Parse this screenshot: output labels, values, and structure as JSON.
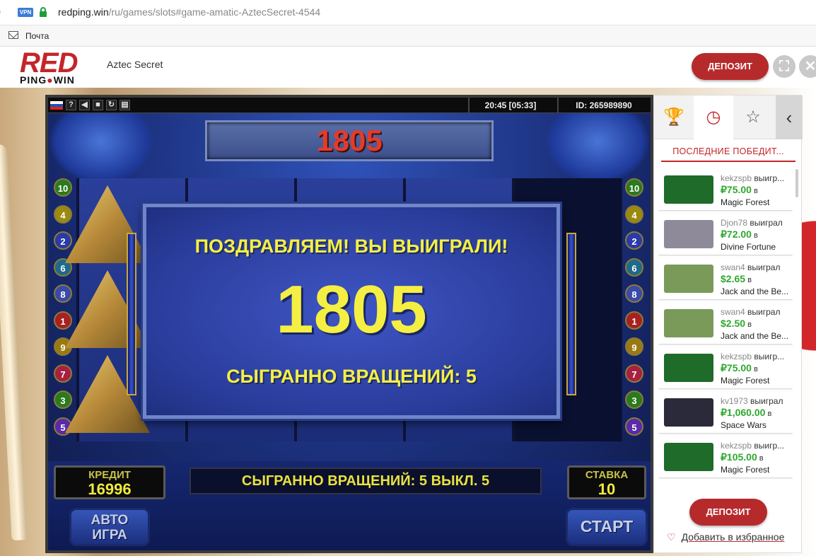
{
  "browser": {
    "vpn_badge": "VPN",
    "url_host": "redping.win",
    "url_path": "/ru/games/slots#game-amatic-AztecSecret-4544",
    "bookmark": "Почта"
  },
  "header": {
    "logo_top": "RED",
    "logo_bottom_left": "PING",
    "logo_bottom_right": "WIN",
    "game_title": "Aztec Secret",
    "deposit_label": "ДЕПОЗИТ",
    "fullscreen_icon": "expand-icon",
    "close_icon": "close-icon"
  },
  "game": {
    "toolbar": {
      "help": "?",
      "clock": "20:45 [05:33]",
      "id": "ID: 265989890"
    },
    "win_top": "1805",
    "line_numbers_left": [
      "10",
      "4",
      "2",
      "6",
      "8",
      "1",
      "9",
      "7",
      "3",
      "5"
    ],
    "line_numbers_right": [
      "10",
      "4",
      "2",
      "6",
      "8",
      "1",
      "9",
      "7",
      "3",
      "5"
    ],
    "dialog": {
      "headline": "ПОЗДРАВЛЯЕМ! ВЫ ВЫИГРАЛИ!",
      "amount": "1805",
      "spins": "СЫГРАННО ВРАЩЕНИЙ: 5"
    },
    "credit_label": "КРЕДИТ",
    "credit_value": "16996",
    "message": "СЫГРАННО ВРАЩЕНИЙ: 5 ВЫКЛ. 5",
    "bet_label": "СТАВКА",
    "bet_value": "10",
    "auto_line1": "АВТО",
    "auto_line2": "ИГРА",
    "start_label": "СТАРТ"
  },
  "sidebar": {
    "tabs": [
      "trophy-icon",
      "clock-icon",
      "star-icon",
      "chevron-left-icon"
    ],
    "heading": "ПОСЛЕДНИЕ ПОБЕДИТ...",
    "winners": [
      {
        "user": "kekzspb",
        "verb": " выигр...",
        "amount": "₽75.00",
        "in": " в",
        "game": "Magic Forest",
        "thumb": "#1f6b2a"
      },
      {
        "user": "Djon78",
        "verb": " выиграл",
        "amount": "₽72.00",
        "in": " в",
        "game": "Divine Fortune",
        "thumb": "#8f8a9a"
      },
      {
        "user": "swan4",
        "verb": " выиграл",
        "amount": "$2.65",
        "in": " в",
        "game": "Jack and the Be...",
        "thumb": "#7a9a5a"
      },
      {
        "user": "swan4",
        "verb": " выиграл",
        "amount": "$2.50",
        "in": " в",
        "game": "Jack and the Be...",
        "thumb": "#7a9a5a"
      },
      {
        "user": "kekzspb",
        "verb": " выигр...",
        "amount": "₽75.00",
        "in": " в",
        "game": "Magic Forest",
        "thumb": "#1f6b2a"
      },
      {
        "user": "kv1973",
        "verb": " выиграл",
        "amount": "₽1,060.00",
        "in": " в",
        "game": "Space Wars",
        "thumb": "#2a2a3a"
      },
      {
        "user": "kekzspb",
        "verb": " выигр...",
        "amount": "₽105.00",
        "in": " в",
        "game": "Magic Forest",
        "thumb": "#1f6b2a"
      }
    ],
    "deposit_label": "ДЕПОЗИТ",
    "favorite_label": "Добавить в избранное"
  }
}
